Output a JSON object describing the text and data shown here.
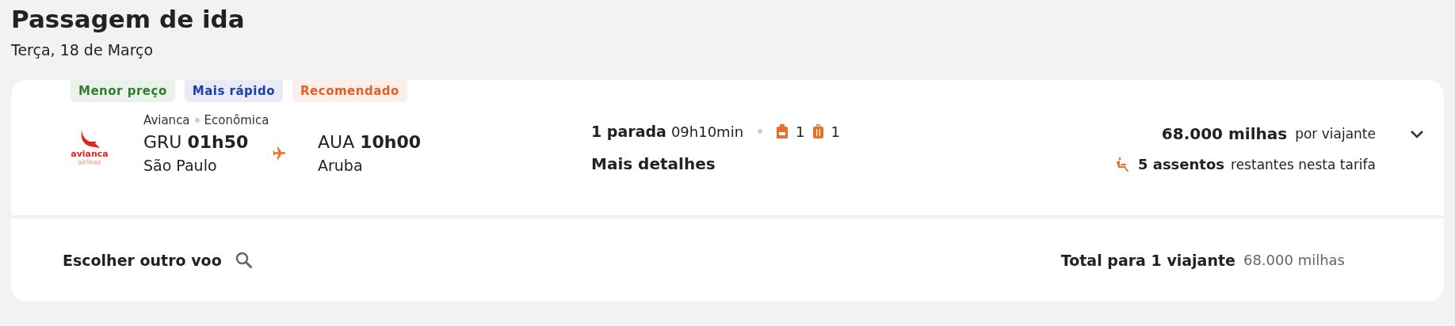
{
  "header": {
    "title": "Passagem de ida",
    "date": "Terça, 18 de Março"
  },
  "tags": [
    {
      "label": "Menor preço",
      "color": "#2e7d32"
    },
    {
      "label": "Mais rápido",
      "color": "#1e3fa8"
    },
    {
      "label": "Recomendado",
      "color": "#e0622a"
    }
  ],
  "flight": {
    "logo": {
      "name": "avianca",
      "sub": "airlines"
    },
    "airline": "Avianca",
    "cabin": "Econômica",
    "departure": {
      "code": "GRU",
      "time": "01h50",
      "city": "São Paulo"
    },
    "arrival": {
      "code": "AUA",
      "time": "10h00",
      "city": "Aruba"
    },
    "stops": "1 parada",
    "duration": "09h10min",
    "backpack_count": "1",
    "suitcase_count": "1",
    "details_link": "Mais detalhes",
    "price": "68.000 milhas",
    "price_unit": "por viajante",
    "seats": "5 assentos",
    "seats_note": "restantes nesta tarifa",
    "expanded": false
  },
  "footer": {
    "choose_other": "Escolher outro voo",
    "total_label": "Total para 1 viajante",
    "total_value": "68.000 milhas"
  }
}
